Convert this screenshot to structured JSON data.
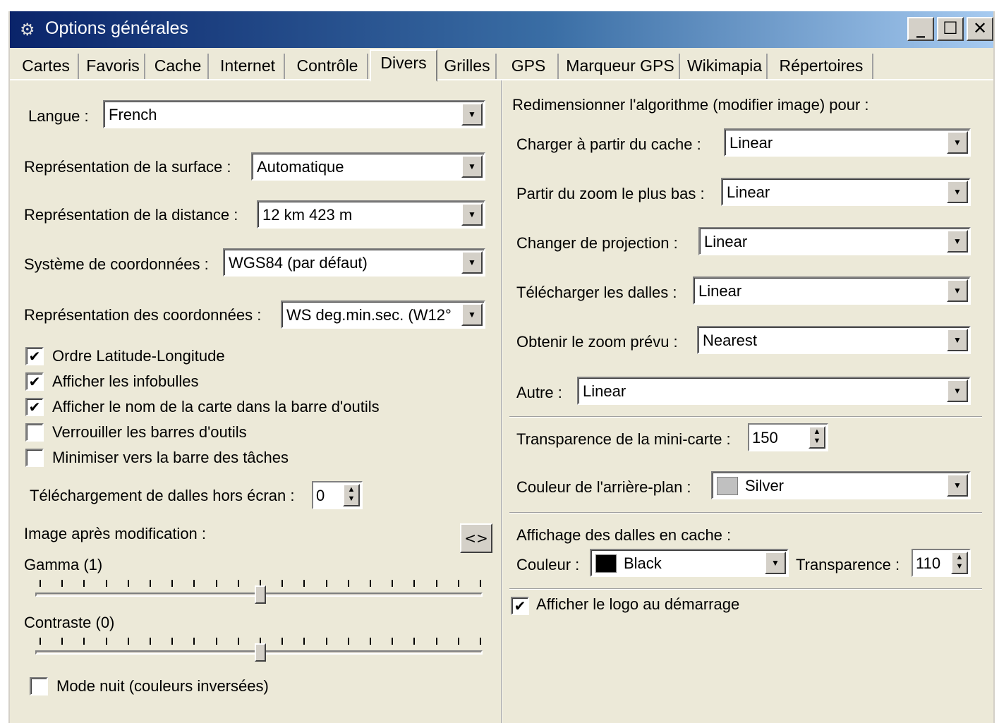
{
  "window": {
    "title": "Options générales"
  },
  "tabs": [
    "Cartes",
    "Favoris",
    "Cache",
    "Internet",
    "Contrôle",
    "Divers",
    "Grilles",
    "GPS",
    "Marqueur GPS",
    "Wikimapia",
    "Répertoires"
  ],
  "active_tab": "Divers",
  "left": {
    "langue": {
      "label": "Langue :",
      "value": "French"
    },
    "surface": {
      "label": "Représentation de la surface :",
      "value": "Automatique"
    },
    "distance": {
      "label": "Représentation de la distance :",
      "value": "12 km 423 m"
    },
    "systeme": {
      "label": "Système de coordonnées :",
      "value": "WGS84 (par défaut)"
    },
    "coord_repr": {
      "label": "Représentation des coordonnées :",
      "value": "WS deg.min.sec. (W12°"
    },
    "checkboxes": [
      {
        "label": "Ordre Latitude-Longitude",
        "checked": true
      },
      {
        "label": "Afficher les infobulles",
        "checked": true
      },
      {
        "label": "Afficher le nom de la carte dans la barre d'outils",
        "checked": true
      },
      {
        "label": "Verrouiller les barres d'outils",
        "checked": false
      },
      {
        "label": "Minimiser vers la barre des tâches",
        "checked": false
      }
    ],
    "offscreen": {
      "label": "Téléchargement de dalles hors écran :",
      "value": "0"
    },
    "image_label": "Image après modification :",
    "toggle_button": "<>",
    "gamma": {
      "label": "Gamma (1)",
      "level": 0.5
    },
    "contraste": {
      "label": "Contraste (0)",
      "level": 0.5
    },
    "night": {
      "label": "Mode nuit (couleurs inversées)",
      "checked": false
    }
  },
  "right": {
    "heading": "Redimensionner l'algorithme (modifier image) pour :",
    "resize": [
      {
        "label": "Charger à partir du cache :",
        "value": "Linear"
      },
      {
        "label": "Partir du zoom le plus bas :",
        "value": "Linear"
      },
      {
        "label": "Changer de projection :",
        "value": "Linear"
      },
      {
        "label": "Télécharger les dalles :",
        "value": "Linear"
      },
      {
        "label": "Obtenir le zoom prévu :",
        "value": "Nearest"
      },
      {
        "label": "Autre :",
        "value": "Linear"
      }
    ],
    "minimap": {
      "label": "Transparence de la mini-carte :",
      "value": "150"
    },
    "background": {
      "label": "Couleur de l'arrière-plan :",
      "value": "Silver",
      "color": "#c0c0c0"
    },
    "cache_display": {
      "label": "Affichage des dalles en cache :"
    },
    "couleur": {
      "label": "Couleur :",
      "value": "Black",
      "color": "#000000"
    },
    "transparence": {
      "label": "Transparence :",
      "value": "110"
    },
    "logo": {
      "label": "Afficher le logo au démarrage",
      "checked": true
    }
  },
  "check_mark": "✔"
}
